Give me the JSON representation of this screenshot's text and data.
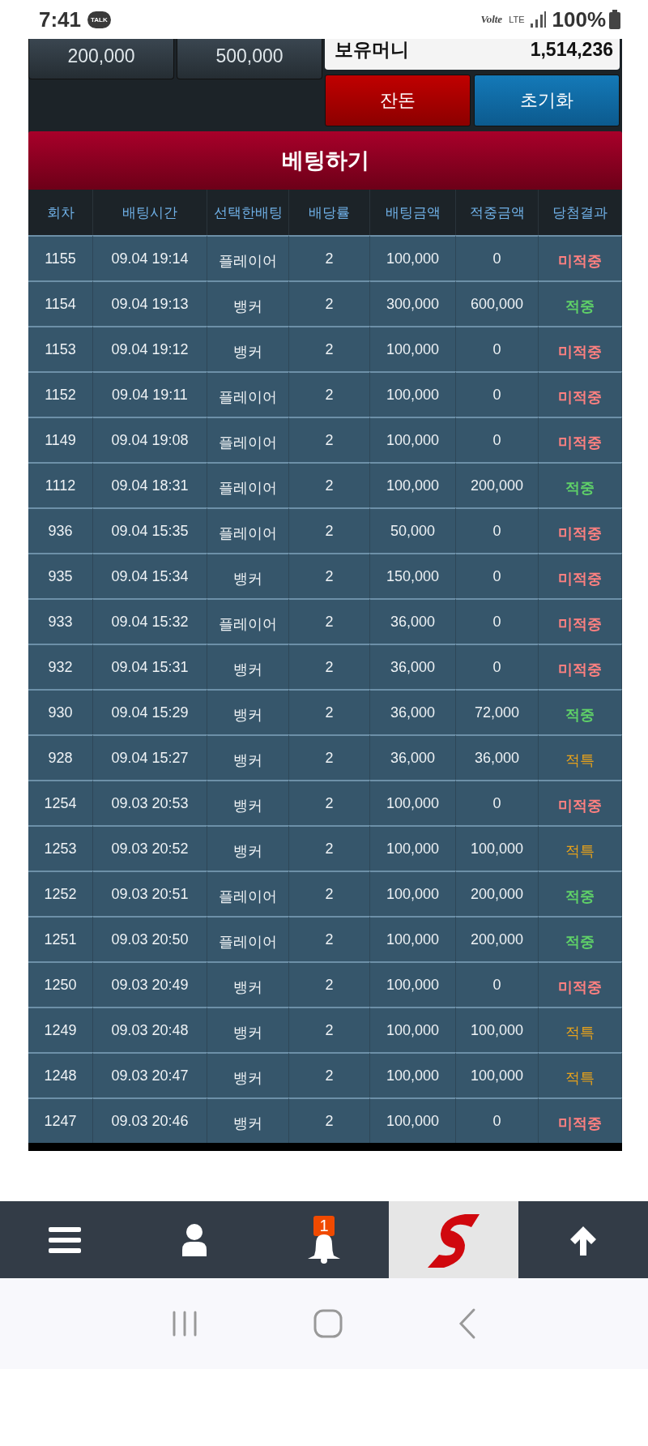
{
  "status_bar": {
    "time": "7:41",
    "talk_badge": "TALK",
    "volte": "Volte",
    "network": "LTE",
    "battery": "100%"
  },
  "top_panel": {
    "quick_amounts": [
      "200,000",
      "500,000"
    ],
    "balance": {
      "label": "보유머니",
      "value": "1,514,236"
    },
    "buttons": [
      {
        "label": "잔돈",
        "kind": "danger"
      },
      {
        "label": "초기화",
        "kind": "primary"
      }
    ]
  },
  "bet_button": "베팅하기",
  "table": {
    "columns": [
      "회차",
      "배팅시간",
      "선택한배팅",
      "배당률",
      "배팅금액",
      "적중금액",
      "당첨결과"
    ],
    "rows": [
      {
        "round": "1155",
        "time": "09.04 19:14",
        "pick": "플레이어",
        "odds": "2",
        "amount": "100,000",
        "payout": "0",
        "result": "미적중",
        "kind": "miss"
      },
      {
        "round": "1154",
        "time": "09.04 19:13",
        "pick": "뱅커",
        "odds": "2",
        "amount": "300,000",
        "payout": "600,000",
        "result": "적중",
        "kind": "hit"
      },
      {
        "round": "1153",
        "time": "09.04 19:12",
        "pick": "뱅커",
        "odds": "2",
        "amount": "100,000",
        "payout": "0",
        "result": "미적중",
        "kind": "miss"
      },
      {
        "round": "1152",
        "time": "09.04 19:11",
        "pick": "플레이어",
        "odds": "2",
        "amount": "100,000",
        "payout": "0",
        "result": "미적중",
        "kind": "miss"
      },
      {
        "round": "1149",
        "time": "09.04 19:08",
        "pick": "플레이어",
        "odds": "2",
        "amount": "100,000",
        "payout": "0",
        "result": "미적중",
        "kind": "miss"
      },
      {
        "round": "1112",
        "time": "09.04 18:31",
        "pick": "플레이어",
        "odds": "2",
        "amount": "100,000",
        "payout": "200,000",
        "result": "적중",
        "kind": "hit"
      },
      {
        "round": "936",
        "time": "09.04 15:35",
        "pick": "플레이어",
        "odds": "2",
        "amount": "50,000",
        "payout": "0",
        "result": "미적중",
        "kind": "miss"
      },
      {
        "round": "935",
        "time": "09.04 15:34",
        "pick": "뱅커",
        "odds": "2",
        "amount": "150,000",
        "payout": "0",
        "result": "미적중",
        "kind": "miss"
      },
      {
        "round": "933",
        "time": "09.04 15:32",
        "pick": "플레이어",
        "odds": "2",
        "amount": "36,000",
        "payout": "0",
        "result": "미적중",
        "kind": "miss"
      },
      {
        "round": "932",
        "time": "09.04 15:31",
        "pick": "뱅커",
        "odds": "2",
        "amount": "36,000",
        "payout": "0",
        "result": "미적중",
        "kind": "miss"
      },
      {
        "round": "930",
        "time": "09.04 15:29",
        "pick": "뱅커",
        "odds": "2",
        "amount": "36,000",
        "payout": "72,000",
        "result": "적중",
        "kind": "hit"
      },
      {
        "round": "928",
        "time": "09.04 15:27",
        "pick": "뱅커",
        "odds": "2",
        "amount": "36,000",
        "payout": "36,000",
        "result": "적특",
        "kind": "refund"
      },
      {
        "round": "1254",
        "time": "09.03 20:53",
        "pick": "뱅커",
        "odds": "2",
        "amount": "100,000",
        "payout": "0",
        "result": "미적중",
        "kind": "miss"
      },
      {
        "round": "1253",
        "time": "09.03 20:52",
        "pick": "뱅커",
        "odds": "2",
        "amount": "100,000",
        "payout": "100,000",
        "result": "적특",
        "kind": "refund"
      },
      {
        "round": "1252",
        "time": "09.03 20:51",
        "pick": "플레이어",
        "odds": "2",
        "amount": "100,000",
        "payout": "200,000",
        "result": "적중",
        "kind": "hit"
      },
      {
        "round": "1251",
        "time": "09.03 20:50",
        "pick": "플레이어",
        "odds": "2",
        "amount": "100,000",
        "payout": "200,000",
        "result": "적중",
        "kind": "hit"
      },
      {
        "round": "1250",
        "time": "09.03 20:49",
        "pick": "뱅커",
        "odds": "2",
        "amount": "100,000",
        "payout": "0",
        "result": "미적중",
        "kind": "miss"
      },
      {
        "round": "1249",
        "time": "09.03 20:48",
        "pick": "뱅커",
        "odds": "2",
        "amount": "100,000",
        "payout": "100,000",
        "result": "적특",
        "kind": "refund"
      },
      {
        "round": "1248",
        "time": "09.03 20:47",
        "pick": "뱅커",
        "odds": "2",
        "amount": "100,000",
        "payout": "100,000",
        "result": "적특",
        "kind": "refund"
      },
      {
        "round": "1247",
        "time": "09.03 20:46",
        "pick": "뱅커",
        "odds": "2",
        "amount": "100,000",
        "payout": "0",
        "result": "미적중",
        "kind": "miss"
      }
    ]
  },
  "bottom_nav": {
    "notification_count": "1"
  }
}
